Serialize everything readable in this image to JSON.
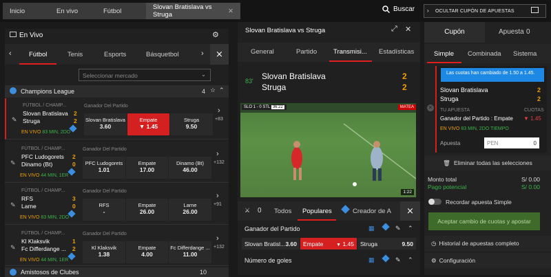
{
  "breadcrumbs": [
    "Inicio",
    "En vivo",
    "Fútbol",
    "Slovan Bratislava vs Struga"
  ],
  "search_label": "Buscar",
  "hide_slip_label": "OCULTAR CUPÓN DE APUESTAS",
  "live": {
    "title": "En Vivo",
    "sports": [
      "Fútbol",
      "Tenis",
      "Esports",
      "Básquetbol"
    ],
    "market_placeholder": "Seleccionar mercado",
    "league": {
      "name": "Champions League",
      "count": "4"
    },
    "matches": [
      {
        "comp": "FÚTBOL / CHAMP...",
        "team1": "Slovan Bratislava",
        "team2": "Struga",
        "s1": "2",
        "s2": "2",
        "status": "EN VIVO",
        "time": "83 MIN, 2DO",
        "market": "Ganador Del Partido",
        "o1n": "Slovan Bratislava",
        "o1v": "3.60",
        "o2n": "Empate",
        "o2v": "1.45",
        "o3n": "Struga",
        "o3v": "9.50",
        "more": "+83"
      },
      {
        "comp": "FÚTBOL / CHAMP...",
        "team1": "PFC Ludogorets",
        "team2": "Dinamo (Bt)",
        "s1": "2",
        "s2": "0",
        "status": "EN VIVO",
        "time": "44 MIN, 1ER",
        "market": "Ganador Del Partido",
        "o1n": "PFC Ludogorets",
        "o1v": "1.01",
        "o2n": "Empate",
        "o2v": "17.00",
        "o3n": "Dinamo (Bt)",
        "o3v": "46.00",
        "more": "+132"
      },
      {
        "comp": "FÚTBOL / CHAMP...",
        "team1": "RFS",
        "team2": "Larne",
        "s1": "3",
        "s2": "0",
        "status": "EN VIVO",
        "time": "83 MIN, 2DO",
        "market": "Ganador Del Partido",
        "o1n": "RFS",
        "o1v": "-",
        "o2n": "Empate",
        "o2v": "26.00",
        "o3n": "Larne",
        "o3v": "26.00",
        "more": "+91"
      },
      {
        "comp": "FÚTBOL / CHAMP...",
        "team1": "Kl Klaksvik",
        "team2": "Fc Differdange ...",
        "s1": "1",
        "s2": "2",
        "status": "EN VIVO",
        "time": "44 MIN, 1ER",
        "market": "Ganador Del Partido",
        "o1n": "Kl Klaksvik",
        "o1v": "1.38",
        "o2n": "Empate",
        "o2v": "4.00",
        "o3n": "Fc Differdange ...",
        "o3v": "11.00",
        "more": "+132"
      }
    ],
    "league2": {
      "name": "Amistosos de Clubes",
      "count": "10"
    }
  },
  "match": {
    "title": "Slovan Bratislava vs Struga",
    "tabs": [
      "General",
      "Partido",
      "Transmisi...",
      "Estadísticas"
    ],
    "minute": "83'",
    "team1": "Slovan Bratislava",
    "team2": "Struga",
    "s1": "2",
    "s2": "2",
    "video": {
      "score": "SLO 1 - 0 STL",
      "clock": "36:22",
      "duration": "1:22",
      "corner": "MATEA"
    },
    "bottom_tabs": {
      "count": "0",
      "todos": "Todos",
      "populares": "Populares",
      "creador": "Creador de A"
    },
    "market1": "Ganador del Partido",
    "o1n": "Slovan Bratisl...",
    "o1v": "3.60",
    "o2n": "Empate",
    "o2v": "1.45",
    "o3n": "Struga",
    "o3v": "9.50",
    "market2": "Número de goles"
  },
  "slip": {
    "tab_coupon": "Cupón",
    "tab_bet": "Apuesta",
    "bet_count": "0",
    "types": [
      "Simple",
      "Combinada",
      "Sistema"
    ],
    "note": "Las cuotas han cambiado de 1.50 a 1.45.",
    "team1": "Slovan Bratislava",
    "team2": "Struga",
    "s1": "2",
    "s2": "2",
    "your_bet": "TU APUESTA",
    "odds_label": "CUOTAS",
    "selection": "Ganador del Partido : Empate",
    "odds": "1.45",
    "status": "EN VIVO",
    "time": "83 MIN, 2DO TIEMPO",
    "stake_label": "Apuesta",
    "currency": "PEN",
    "stake": "0",
    "clear": "Eliminar todas las selecciones",
    "total_label": "Monto total",
    "total": "S/ 0.00",
    "potential_label": "Pago potencial",
    "potential": "S/ 0.00",
    "remember": "Recordar apuesta Simple",
    "accept": "Aceptar cambio de cuotas y apostar",
    "history": "Historial de apuestas completo",
    "config": "Configuración"
  }
}
